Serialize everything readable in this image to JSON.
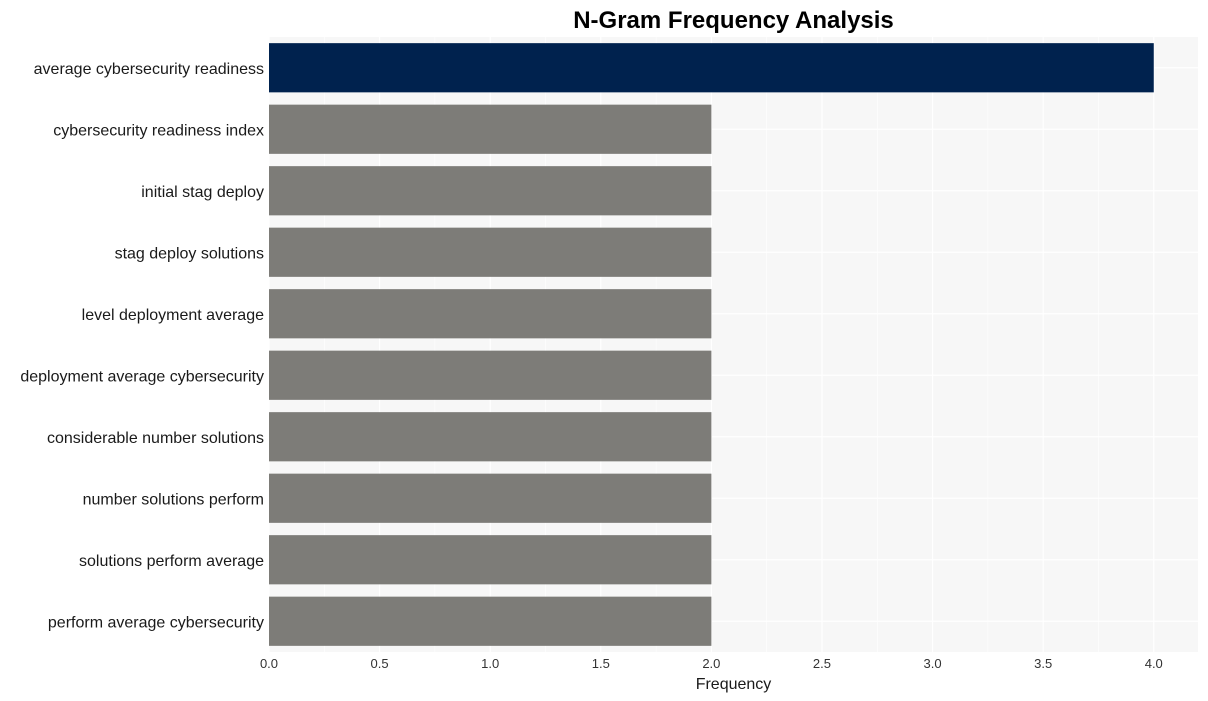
{
  "chart_data": {
    "type": "bar",
    "orientation": "horizontal",
    "title": "N-Gram Frequency Analysis",
    "xlabel": "Frequency",
    "ylabel": "",
    "xlim": [
      0,
      4.2
    ],
    "xticks": [
      0.0,
      0.5,
      1.0,
      1.5,
      2.0,
      2.5,
      3.0,
      3.5,
      4.0
    ],
    "xtick_labels": [
      "0.0",
      "0.5",
      "1.0",
      "1.5",
      "2.0",
      "2.5",
      "3.0",
      "3.5",
      "4.0"
    ],
    "grid": true,
    "categories": [
      "average cybersecurity readiness",
      "cybersecurity readiness index",
      "initial stag deploy",
      "stag deploy solutions",
      "level deployment average",
      "deployment average cybersecurity",
      "considerable number solutions",
      "number solutions perform",
      "solutions perform average",
      "perform average cybersecurity"
    ],
    "values": [
      4,
      2,
      2,
      2,
      2,
      2,
      2,
      2,
      2,
      2
    ],
    "colors": {
      "highlight": "#00224e",
      "default": "#7d7c78",
      "panel_background": "#f7f7f7",
      "grid": "#ffffff"
    }
  }
}
